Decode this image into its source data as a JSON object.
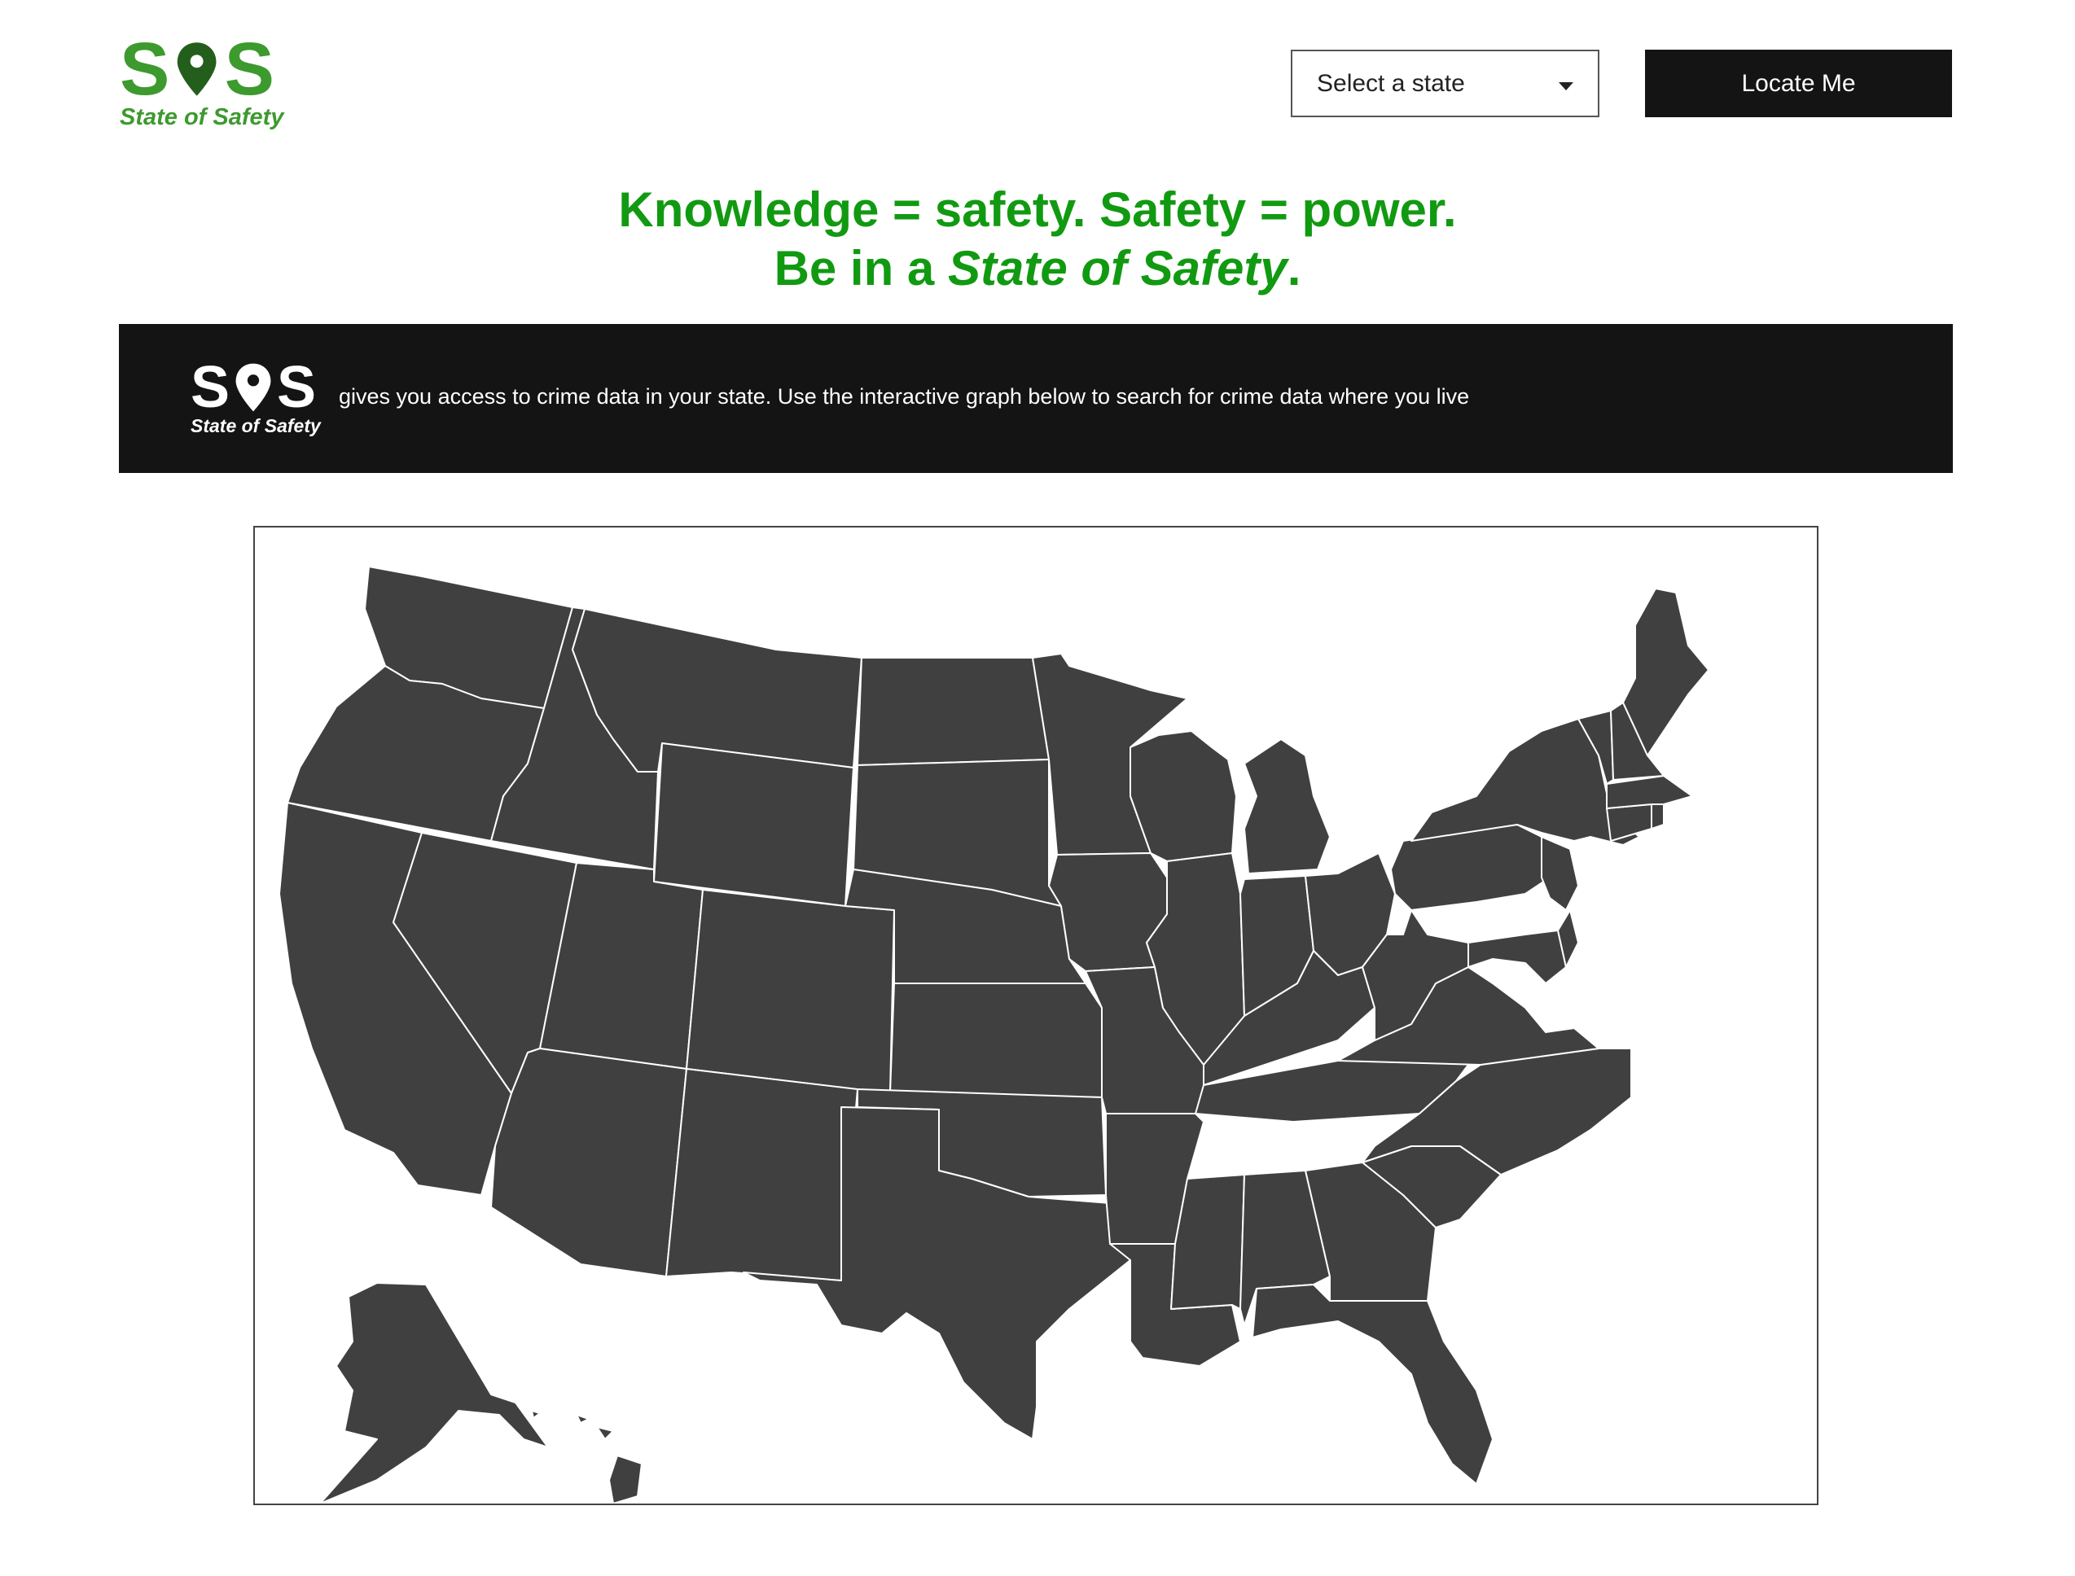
{
  "brand": {
    "letter_left": "S",
    "letter_right": "S",
    "tagline": "State of Safety",
    "primary_color": "#3d9a2e",
    "pin_color": "#245e1c"
  },
  "header": {
    "state_select": {
      "selected": "Select a state",
      "icon": "chevron-down-icon"
    },
    "locate_button": "Locate Me"
  },
  "hero": {
    "line1": "Knowledge = safety. Safety = power.",
    "line2_prefix": "Be in a ",
    "line2_emphasis": "State of Safety",
    "line2_suffix": ".",
    "color": "#119a11"
  },
  "banner": {
    "logo_letter_left": "S",
    "logo_letter_right": "S",
    "logo_tagline": "State of Safety",
    "text": "gives you access to crime data in your state. Use the interactive graph below to search for crime data where you live",
    "background": "#141414"
  },
  "map": {
    "fill_color": "#404040",
    "border_color": "#ffffff"
  }
}
